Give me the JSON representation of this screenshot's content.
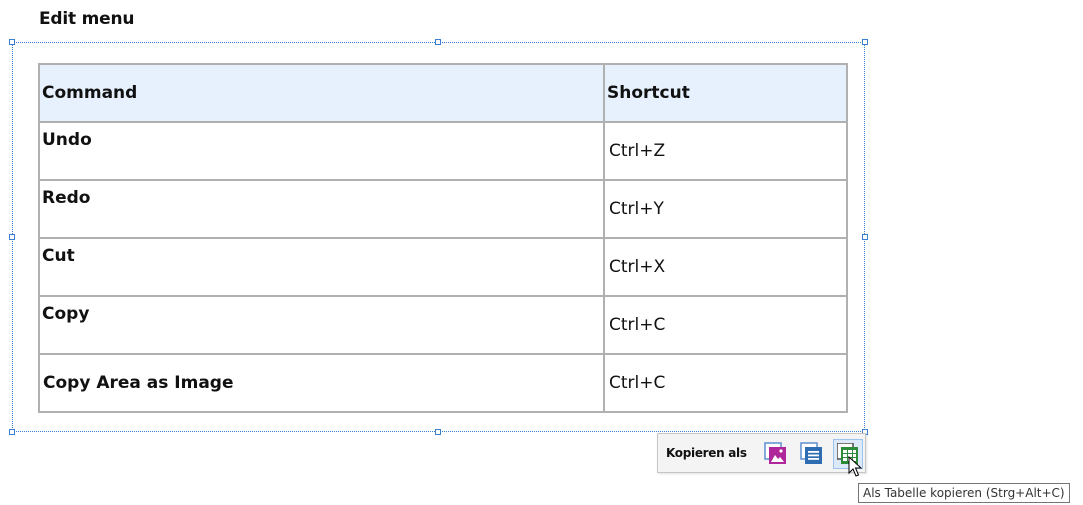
{
  "heading": "Edit menu",
  "table": {
    "headers": [
      "Command",
      "Shortcut"
    ],
    "rows": [
      {
        "command": "Undo",
        "shortcut": "Ctrl+Z"
      },
      {
        "command": "Redo",
        "shortcut": "Ctrl+Y"
      },
      {
        "command": "Cut",
        "shortcut": "Ctrl+X"
      },
      {
        "command": "Copy",
        "shortcut": "Ctrl+C"
      },
      {
        "command": "Copy Area as Image",
        "shortcut": "Ctrl+C"
      }
    ]
  },
  "copy_toolbar": {
    "label": "Kopieren als",
    "buttons": [
      {
        "icon": "image-icon"
      },
      {
        "icon": "text-document-icon"
      },
      {
        "icon": "table-grid-icon",
        "active": true
      }
    ]
  },
  "tooltip": "Als Tabelle kopieren (Strg+Alt+C)",
  "colors": {
    "selection": "#3b7fd0",
    "header_background": "#e6f1fd",
    "table_border": "#b0b0b0",
    "image_icon": "#b0279c",
    "doc_icon": "#2f6db3",
    "table_icon": "#2e8b3a"
  }
}
